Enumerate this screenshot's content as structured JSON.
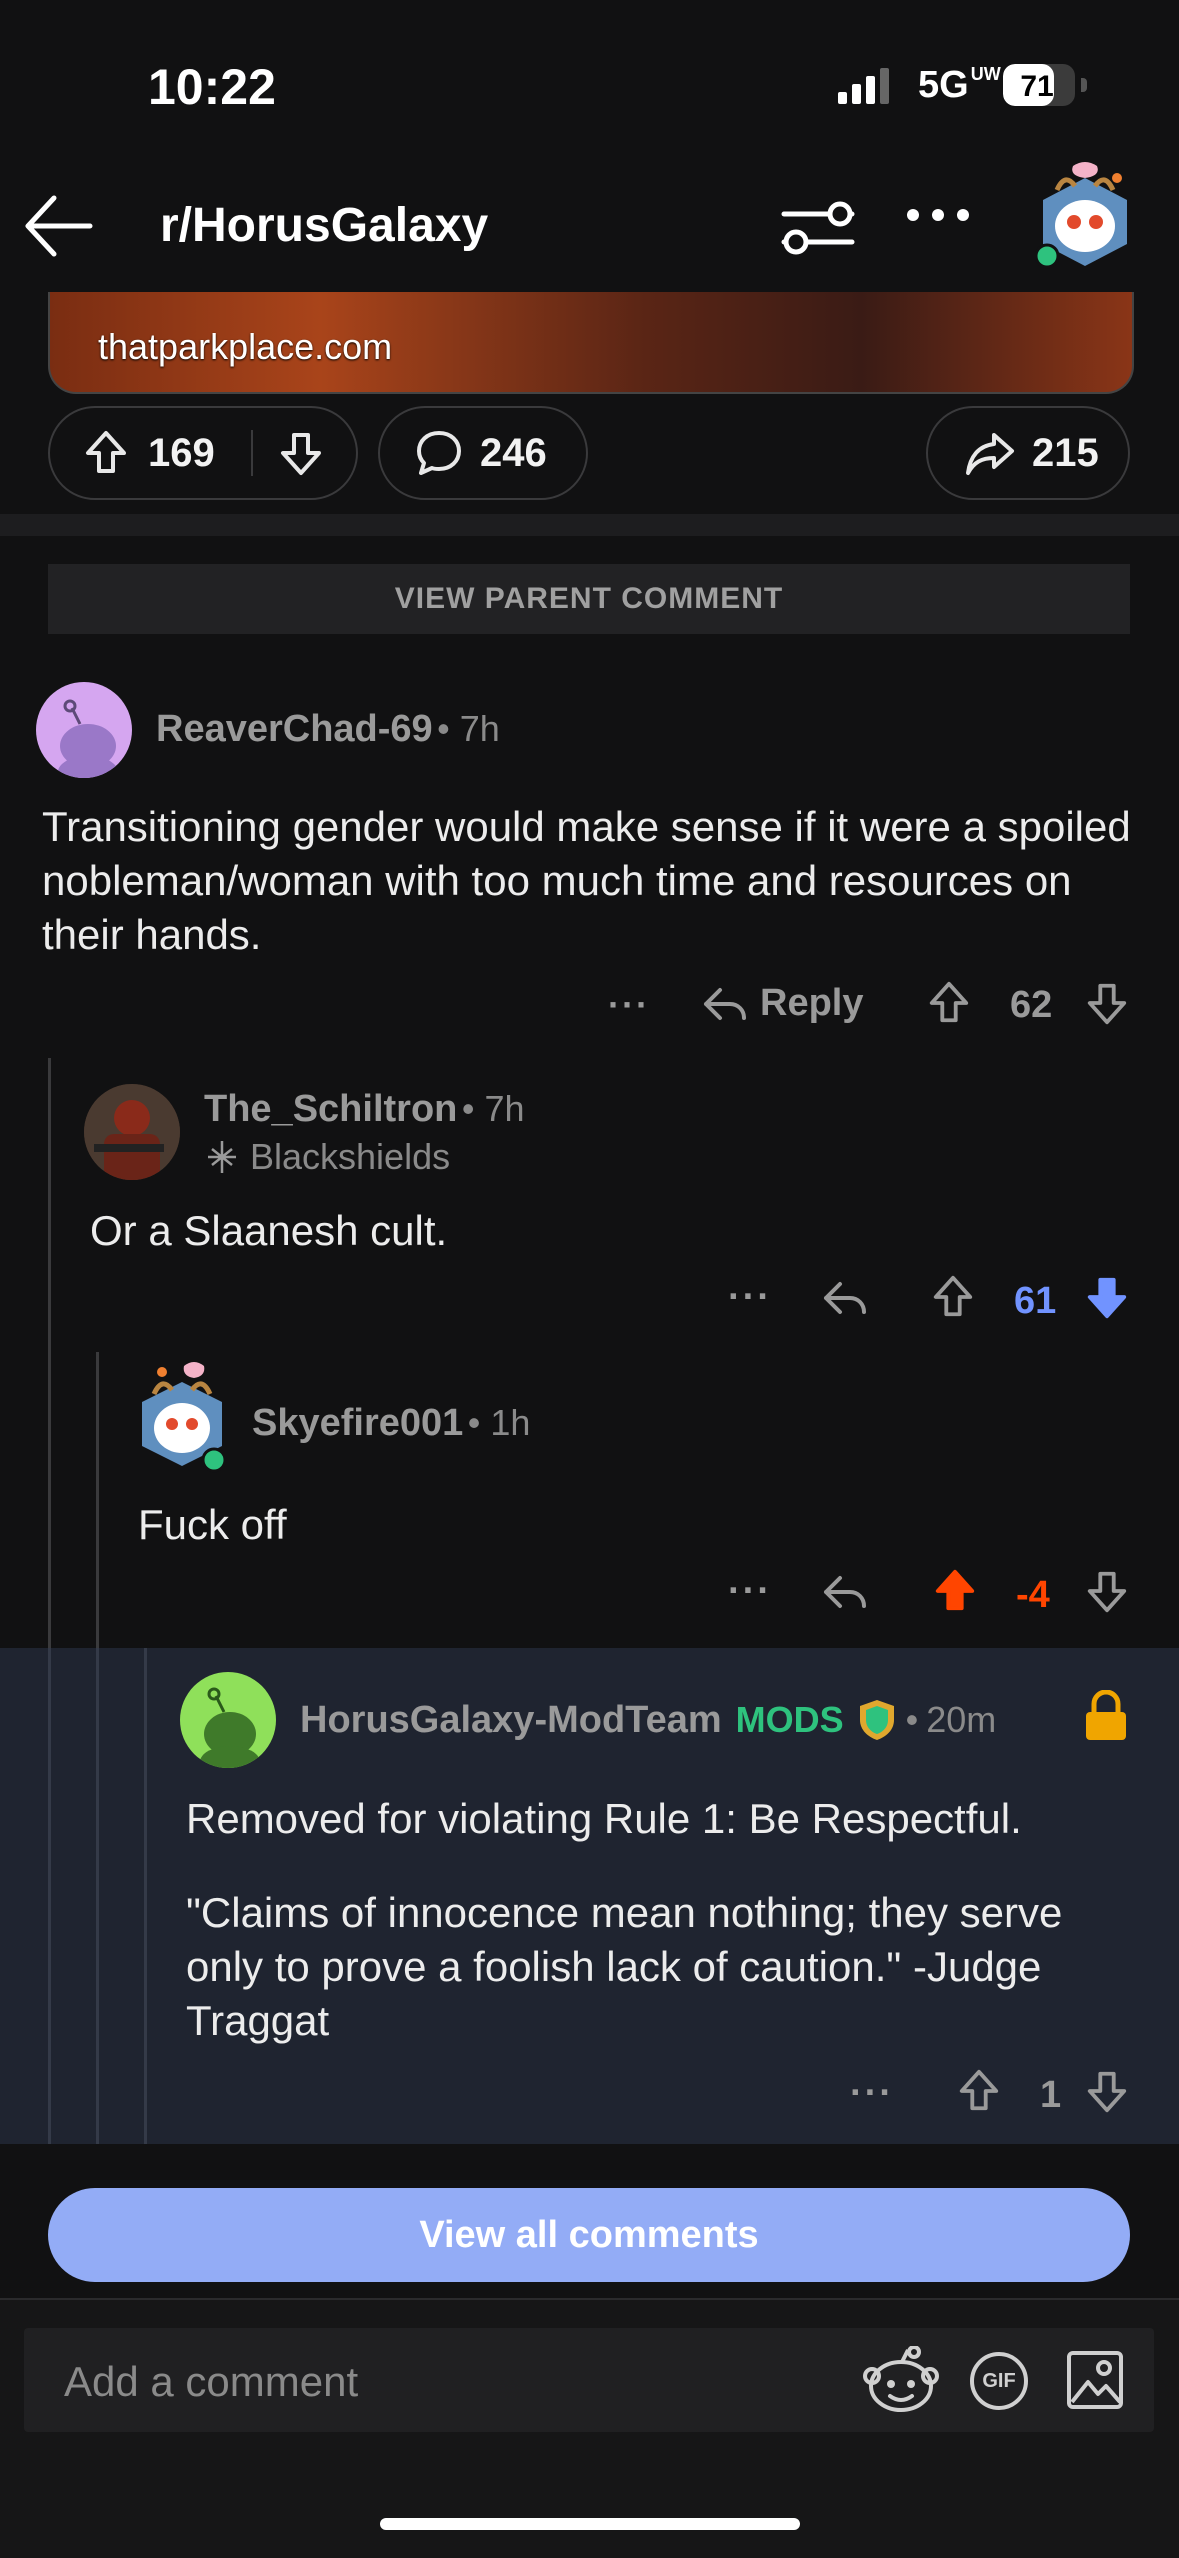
{
  "status_bar": {
    "time": "10:22",
    "network": "5G",
    "network_sub": "UW",
    "battery": "71"
  },
  "header": {
    "title": "r/HorusGalaxy"
  },
  "post": {
    "link_domain": "thatparkplace.com",
    "upvotes": "169",
    "comments": "246",
    "shares": "215"
  },
  "view_parent_label": "VIEW PARENT COMMENT",
  "comments": [
    {
      "author": "ReaverChad-69",
      "age": "7h",
      "body": "Transitioning gender would make sense if it were a spoiled nobleman/woman with too much time and resources on their hands.",
      "reply_label": "Reply",
      "score": "62",
      "more": "···"
    },
    {
      "author": "The_Schiltron",
      "age": "7h",
      "flair": "Blackshields",
      "body": "Or a Slaanesh cult.",
      "score": "61",
      "more": "···"
    },
    {
      "author": "Skyefire001",
      "age": "1h",
      "body": "Fuck off",
      "score": "-4",
      "more": "···"
    },
    {
      "author": "HorusGalaxy-ModTeam",
      "mods_tag": "MODS",
      "age": "20m",
      "body1": "Removed for violating Rule 1: Be Respectful.",
      "body2": "\"Claims of innocence mean nothing; they serve only to prove a foolish lack of caution.\" -Judge Traggat",
      "score": "1",
      "more": "···"
    }
  ],
  "view_all_label": "View all comments",
  "input": {
    "placeholder": "Add a comment",
    "gif_label": "GIF"
  },
  "colors": {
    "upvote_active": "#ff4500",
    "downvote_active": "#7193ff",
    "mods_green": "#2ec27e",
    "view_all_bg": "#93acf6"
  }
}
